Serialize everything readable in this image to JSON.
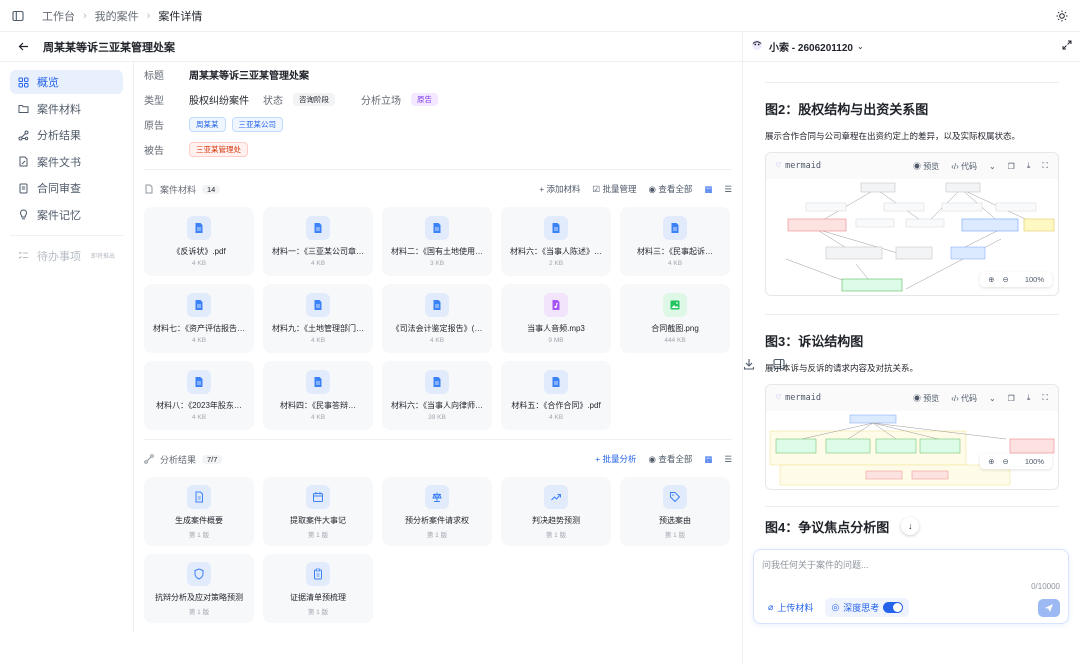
{
  "breadcrumb": {
    "items": [
      "工作台",
      "我的案件"
    ],
    "current": "案件详情"
  },
  "case_header": {
    "title": "周某某等诉三亚某管理处案"
  },
  "sidebar": {
    "items": [
      {
        "label": "概览",
        "icon": "grid-icon",
        "active": true
      },
      {
        "label": "案件材料",
        "icon": "folder-icon"
      },
      {
        "label": "分析结果",
        "icon": "nodes-icon"
      },
      {
        "label": "案件文书",
        "icon": "doc-pen-icon"
      },
      {
        "label": "合同审查",
        "icon": "contract-icon"
      },
      {
        "label": "案件记忆",
        "icon": "bulb-icon"
      }
    ],
    "todo": {
      "label": "待办事项",
      "tag": "即将推出"
    }
  },
  "info": {
    "title_label": "标题",
    "title_value": "周某某等诉三亚某管理处案",
    "type_label": "类型",
    "type_value": "股权纠纷案件",
    "status_label": "状态",
    "status_value": "咨询阶段",
    "stance_label": "分析立场",
    "stance_value": "原告",
    "plaintiff_label": "原告",
    "plaintiffs": [
      "周某某",
      "三亚某公司"
    ],
    "defendant_label": "被告",
    "defendants": [
      "三亚某管理处"
    ]
  },
  "materials": {
    "label": "案件材料",
    "count": "14",
    "actions": {
      "add": "+ 添加材料",
      "batch": "批量管理",
      "view_all": "查看全部"
    },
    "files": [
      {
        "name": "《反诉状》.pdf",
        "size": "4 KB",
        "type": "doc"
      },
      {
        "name": "材料一：《三亚某公司章…",
        "size": "4 KB",
        "type": "doc"
      },
      {
        "name": "材料二：《国有土地使用…",
        "size": "3 KB",
        "type": "doc"
      },
      {
        "name": "材料六：《当事人陈述》…",
        "size": "2 KB",
        "type": "doc"
      },
      {
        "name": "材料三：《民事起诉…",
        "size": "4 KB",
        "type": "doc"
      },
      {
        "name": "材料七：《资产评估报告…",
        "size": "4 KB",
        "type": "doc"
      },
      {
        "name": "材料九：《土地管理部门…",
        "size": "4 KB",
        "type": "doc"
      },
      {
        "name": "《司法会计鉴定报告》(…",
        "size": "4 KB",
        "type": "doc"
      },
      {
        "name": "当事人音频.mp3",
        "size": "9 MB",
        "type": "audio"
      },
      {
        "name": "合同截图.png",
        "size": "444 KB",
        "type": "image"
      },
      {
        "name": "材料八：《2023年股东…",
        "size": "4 KB",
        "type": "doc"
      },
      {
        "name": "材料四：《民事答辩…",
        "size": "4 KB",
        "type": "doc"
      },
      {
        "name": "材料六：《当事人向律师…",
        "size": "39 KB",
        "type": "doc"
      },
      {
        "name": "材料五：《合作合同》.pdf",
        "size": "4 KB",
        "type": "doc"
      }
    ]
  },
  "analysis": {
    "label": "分析结果",
    "count": "7/7",
    "actions": {
      "batch": "+ 批量分析",
      "view_all": "查看全部"
    },
    "items": [
      {
        "name": "生成案件概要",
        "ver": "第 1 版",
        "icon": "doc-icon"
      },
      {
        "name": "提取案件大事记",
        "ver": "第 1 版",
        "icon": "calendar-icon"
      },
      {
        "name": "预分析案件请求权",
        "ver": "第 1 版",
        "icon": "scale-icon"
      },
      {
        "name": "判决趋势预测",
        "ver": "第 1 版",
        "icon": "trend-icon"
      },
      {
        "name": "预选案由",
        "ver": "第 1 版",
        "icon": "tag-icon"
      },
      {
        "name": "抗辩分析及应对策略预测",
        "ver": "第 1 版",
        "icon": "shield-icon"
      },
      {
        "name": "证据清单预梳理",
        "ver": "第 1 版",
        "icon": "clipboard-icon"
      }
    ]
  },
  "assistant": {
    "title": "小索 - 2606201120",
    "figures": [
      {
        "title": "图2：股权结构与出资关系图",
        "desc": "展示合作合同与公司章程在出资约定上的差异，以及实际权属状态。",
        "zoom": "100%"
      },
      {
        "title": "图3：诉讼结构图",
        "desc": "展示本诉与反诉的请求内容及对抗关系。",
        "zoom": "100%"
      },
      {
        "title": "图4：争议焦点分析图"
      }
    ],
    "mermaid_label": "mermaid",
    "preview_label": "预览",
    "code_label": "代码",
    "chat": {
      "placeholder": "问我任何关于案件的问题...",
      "counter": "0/10000",
      "upload": "上传材料",
      "deep": "深度思考"
    }
  }
}
